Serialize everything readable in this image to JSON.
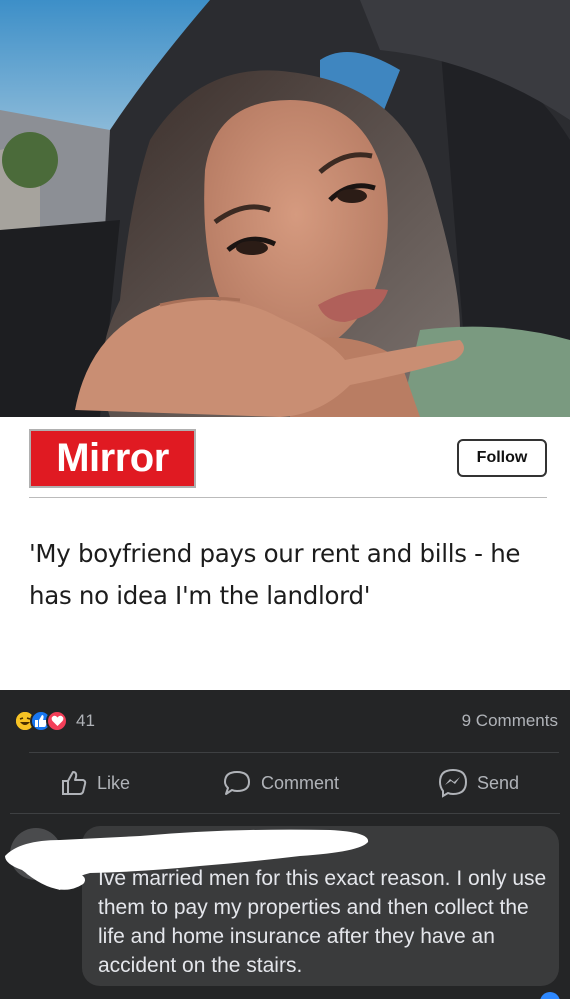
{
  "article": {
    "source_logo": "Mirror",
    "follow_label": "Follow",
    "headline": "'My boyfriend pays our rent and bills - he has no idea I'm the landlord'"
  },
  "post_stats": {
    "reaction_icons": [
      "haha-reaction-icon",
      "like-reaction-icon",
      "love-reaction-icon"
    ],
    "reaction_count": "41",
    "comments_count": "9 Comments"
  },
  "actions": {
    "like_label": "Like",
    "comment_label": "Comment",
    "send_label": "Send"
  },
  "comment": {
    "author": "",
    "text": "Ive married men for this exact reason. I only use them to pay my properties and then collect the life and home insurance after they have an accident on the stairs."
  },
  "colors": {
    "mirror_red": "#e01a22",
    "dark_background": "#242526",
    "comment_bubble": "#3a3b3c",
    "secondary_text": "#b0b3b8",
    "like_blue": "#1877f2",
    "love_red": "#f33e58",
    "haha_yellow": "#f7c324"
  }
}
